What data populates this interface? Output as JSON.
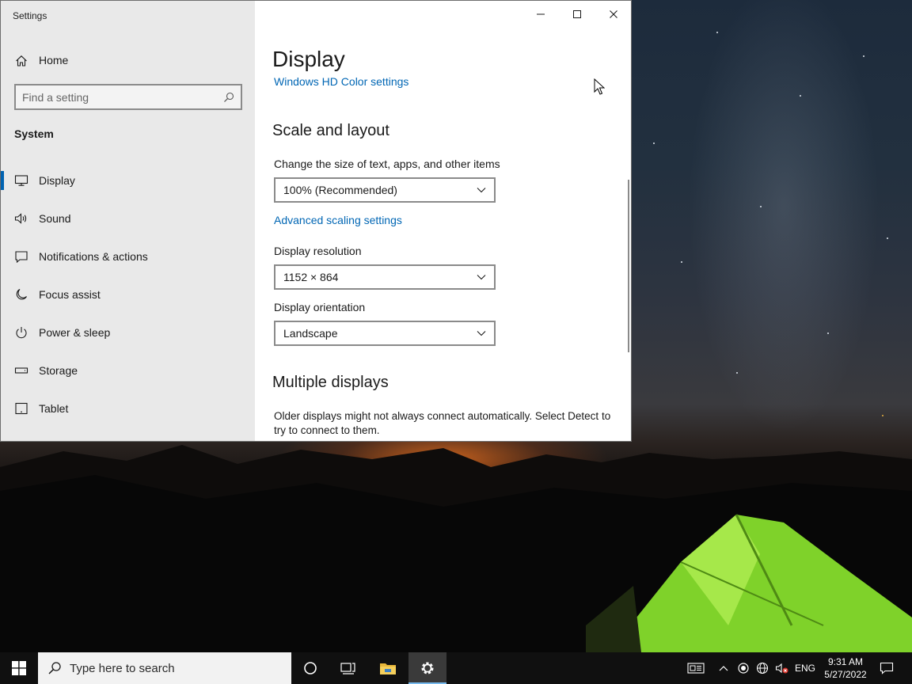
{
  "window": {
    "app_title": "Settings",
    "controls": [
      "minimize-button",
      "maximize-button",
      "close-button"
    ]
  },
  "sidebar": {
    "home_label": "Home",
    "search_placeholder": "Find a setting",
    "section_title": "System",
    "items": [
      {
        "label": "Display",
        "icon": "monitor-icon",
        "selected": true
      },
      {
        "label": "Sound",
        "icon": "speaker-icon"
      },
      {
        "label": "Notifications & actions",
        "icon": "message-icon"
      },
      {
        "label": "Focus assist",
        "icon": "moon-icon"
      },
      {
        "label": "Power & sleep",
        "icon": "power-icon"
      },
      {
        "label": "Storage",
        "icon": "drive-icon"
      },
      {
        "label": "Tablet",
        "icon": "tablet-icon"
      }
    ]
  },
  "main": {
    "page_title": "Display",
    "hd_color_link": "Windows HD Color settings",
    "scale_section": {
      "title": "Scale and layout",
      "size_label": "Change the size of text, apps, and other items",
      "size_value": "100% (Recommended)",
      "advanced_link": "Advanced scaling settings",
      "resolution_label": "Display resolution",
      "resolution_value": "1152 × 864",
      "orientation_label": "Display orientation",
      "orientation_value": "Landscape"
    },
    "multiple_displays": {
      "title": "Multiple displays",
      "description": "Older displays might not always connect automatically. Select Detect to try to connect to them."
    }
  },
  "taskbar": {
    "search_placeholder": "Type here to search",
    "language": "ENG",
    "time": "9:31 AM",
    "date": "5/27/2022"
  },
  "colors": {
    "accent": "#0063b1",
    "link": "#0066b4",
    "sidebar_bg": "#e9e9e9",
    "taskbar_bg": "#101010"
  }
}
